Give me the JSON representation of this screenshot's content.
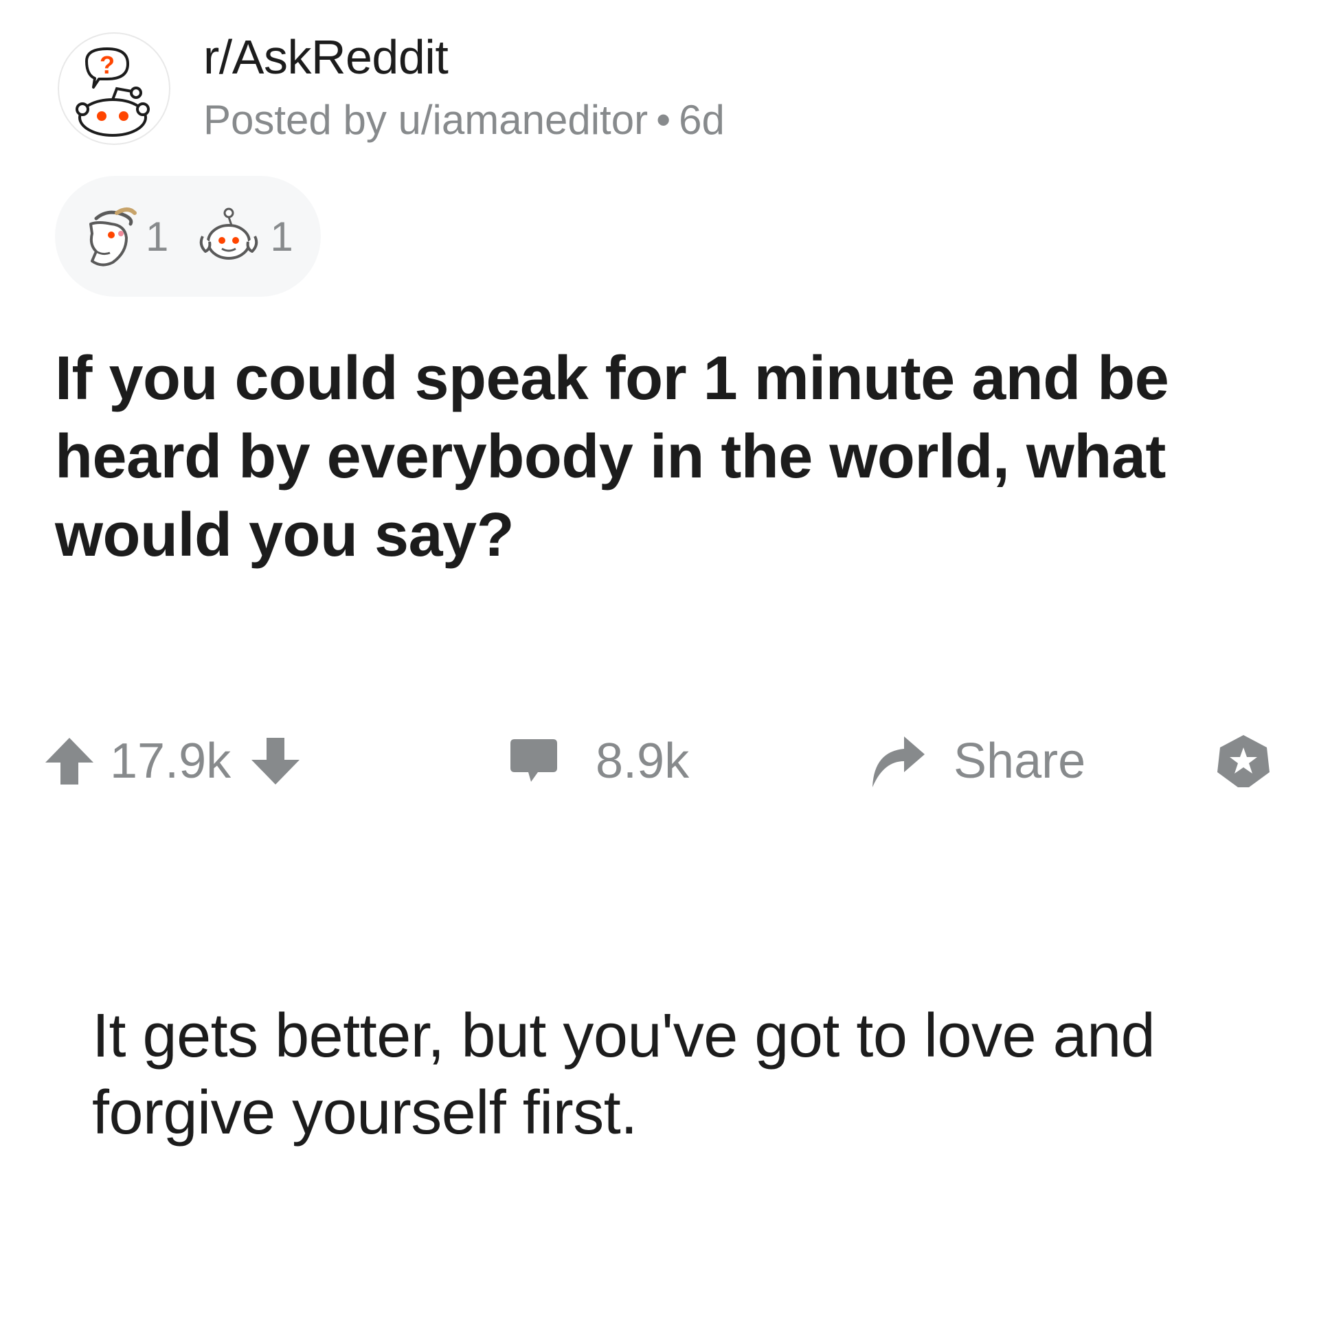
{
  "post": {
    "subreddit": "r/AskReddit",
    "posted_by_prefix": "Posted by",
    "author": "u/iamaneditor",
    "separator": "•",
    "age": "6d",
    "awards": [
      {
        "icon": "goat-award-icon",
        "count": "1"
      },
      {
        "icon": "wholesome-snoo-award-icon",
        "count": "1"
      }
    ],
    "title": "If you could speak for 1 minute and be heard by everybody in the world, what would you say?"
  },
  "actions": {
    "score": "17.9k",
    "comments": "8.9k",
    "share_label": "Share"
  },
  "comment": {
    "text": "It gets better, but you've got to love and forgive yourself first."
  },
  "colors": {
    "meta_gray": "#878a8c",
    "text_dark": "#1c1c1c",
    "reddit_orange": "#ff4500",
    "pill_bg": "#f6f7f8"
  }
}
